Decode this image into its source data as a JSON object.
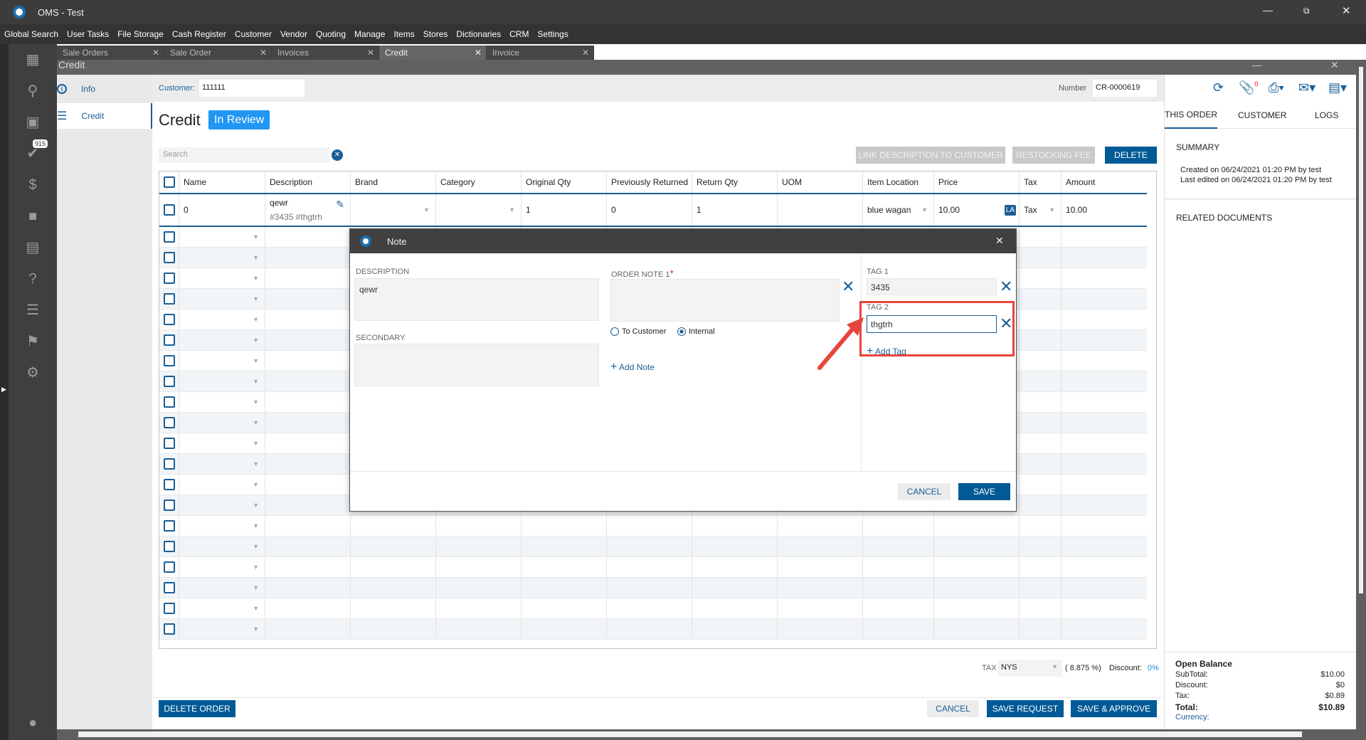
{
  "app": {
    "title": "OMS - Test"
  },
  "menu": [
    "Global Search",
    "User Tasks",
    "File Storage",
    "Cash Register",
    "Customer",
    "Vendor",
    "Quoting",
    "Manage",
    "Items",
    "Stores",
    "Dictionaries",
    "CRM",
    "Settings"
  ],
  "tabs": [
    {
      "label": "Sale Orders"
    },
    {
      "label": "Sale Order"
    },
    {
      "label": "Invoices"
    },
    {
      "label": "Credit",
      "active": true
    },
    {
      "label": "Invoice"
    }
  ],
  "sidebar": {
    "badge": "915"
  },
  "header": {
    "window_title": "Credit"
  },
  "leftnav": {
    "info": "Info",
    "credit": "Credit"
  },
  "customer": {
    "label": "Customer:",
    "value": "111111"
  },
  "number": {
    "label": "Number",
    "value": "CR-0000619"
  },
  "page": {
    "title": "Credit",
    "status": "In Review",
    "search_placeholder": "Search"
  },
  "toolbar": {
    "link": "LINK DESCRIPTION TO CUSTOMER",
    "restock": "RESTOCKING FEE",
    "delete": "DELETE",
    "attach_count": "0"
  },
  "grid": {
    "columns": [
      "Name",
      "Description",
      "Brand",
      "Category",
      "Original Qty",
      "Previously Returned",
      "Return Qty",
      "UOM",
      "Item Location",
      "Price",
      "Tax",
      "Amount"
    ],
    "rows": [
      {
        "name": "0",
        "description": "qewr",
        "tags": "#3435 #thgtrh",
        "brand": "",
        "category": "",
        "original_qty": "1",
        "previously_returned": "0",
        "return_qty": "1",
        "uom": "",
        "item_location": "blue wagan",
        "price": "10.00",
        "price_badge": "LA",
        "tax": "Tax",
        "amount": "10.00"
      }
    ]
  },
  "dialog": {
    "title": "Note",
    "description_label": "DESCRIPTION",
    "description_value": "qewr",
    "secondary_label": "SECONDARY",
    "order_note_label": "ORDER NOTE 1",
    "required": "*",
    "radio_customer": "To Customer",
    "radio_internal": "Internal",
    "add_note": "Add Note",
    "tag1_label": "TAG 1",
    "tag1_value": "3435",
    "tag2_label": "TAG 2",
    "tag2_value": "thgtrh",
    "add_tag": "Add Tag",
    "cancel": "CANCEL",
    "save": "SAVE"
  },
  "footer": {
    "tax_label": "TAX",
    "tax_value": "NYS",
    "tax_rate": "( 8.875 %)",
    "discount_label": "Discount:",
    "discount_value": "0%",
    "delete_order": "DELETE ORDER",
    "cancel": "CANCEL",
    "save_request": "SAVE REQUEST",
    "save_approve": "SAVE & APPROVE"
  },
  "right": {
    "tabs": [
      "THIS ORDER",
      "CUSTOMER",
      "LOGS"
    ],
    "summary": "SUMMARY",
    "created": "Created on 06/24/2021 01:20 PM by test",
    "edited": "Last edited on 06/24/2021 01:20 PM by test",
    "related": "RELATED DOCUMENTS",
    "balance": {
      "title": "Open Balance",
      "subtotal_label": "SubTotal:",
      "subtotal": "$10.00",
      "discount_label": "Discount:",
      "discount": "$0",
      "tax_label": "Tax:",
      "tax": "$0.89",
      "total_label": "Total:",
      "total": "$10.89",
      "currency_label": "Currency:"
    }
  }
}
